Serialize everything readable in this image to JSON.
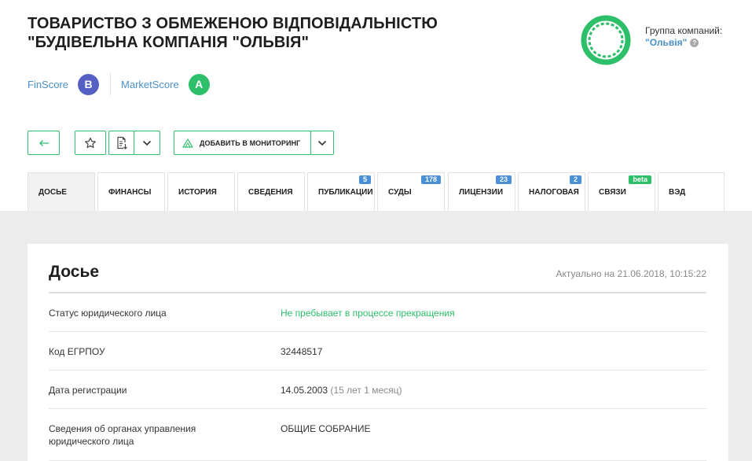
{
  "company": {
    "title": "ТОВАРИСТВО З ОБМЕЖЕНОЮ ВІДПОВІДАЛЬНІСТЮ \"БУДІВЕЛЬНА КОМПАНІЯ \"ОЛЬВІЯ\""
  },
  "scores": {
    "finscore_label": "FinScore",
    "finscore_grade": "B",
    "marketscore_label": "MarketScore",
    "marketscore_grade": "A"
  },
  "group": {
    "label": "Группа компаний:",
    "name": "\"Ольвія\"",
    "help": "?"
  },
  "toolbar": {
    "monitor_label": "ДОБАВИТЬ В МОНИТОРИНГ"
  },
  "tabs": [
    {
      "label": "ДОСЬЕ",
      "badge": ""
    },
    {
      "label": "ФИНАНСЫ",
      "badge": ""
    },
    {
      "label": "ИСТОРИЯ",
      "badge": ""
    },
    {
      "label": "СВЕДЕНИЯ",
      "badge": ""
    },
    {
      "label": "ПУБЛИКАЦИИ",
      "badge": "5"
    },
    {
      "label": "СУДЫ",
      "badge": "178"
    },
    {
      "label": "ЛИЦЕНЗИИ",
      "badge": "23"
    },
    {
      "label": "НАЛОГОВАЯ",
      "badge": "2"
    },
    {
      "label": "СВЯЗИ",
      "badge": "beta"
    },
    {
      "label": "ВЭД",
      "badge": ""
    }
  ],
  "dossier": {
    "title": "Досье",
    "updated": "Актуально на 21.06.2018, 10:15:22",
    "rows": [
      {
        "label": "Статус юридического лица",
        "value": "Не пребывает в процессе прекращения",
        "extra": ""
      },
      {
        "label": "Код ЕГРПОУ",
        "value": "32448517",
        "extra": ""
      },
      {
        "label": "Дата регистрации",
        "value": "14.05.2003",
        "extra": "(15 лет 1 месяц)"
      },
      {
        "label": "Сведения об органах управления юридического лица",
        "value": "ОБЩИЕ СОБРАНИЕ",
        "extra": ""
      }
    ]
  },
  "colors": {
    "accent_green": "#2dbf6a",
    "link_blue": "#4a90c8",
    "finscore_badge": "#5560c4",
    "tab_badge_blue": "#4a90d6"
  }
}
